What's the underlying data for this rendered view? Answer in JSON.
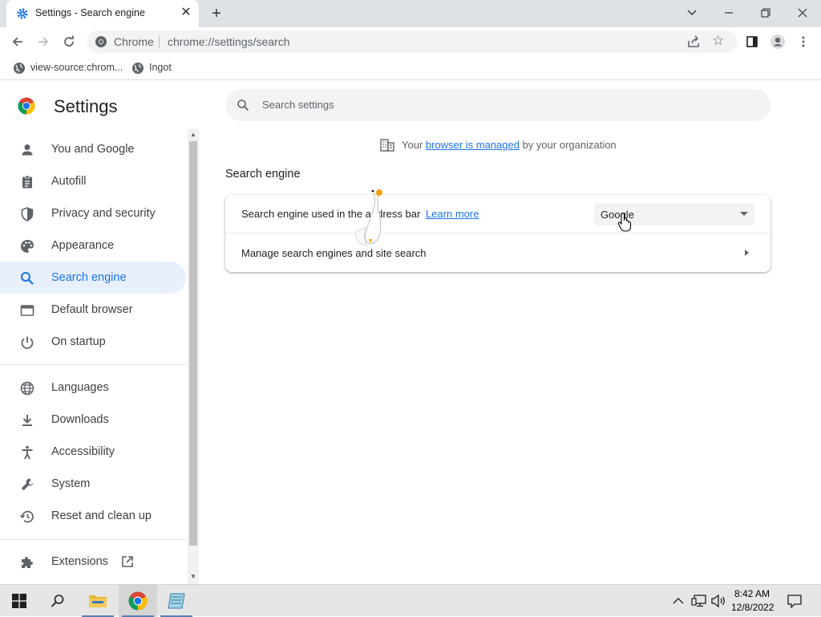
{
  "browser": {
    "tab_title": "Settings - Search engine",
    "omnibox_chip": "Chrome",
    "url": "chrome://settings/search"
  },
  "bookmarks": [
    {
      "label": "view-source:chrom..."
    },
    {
      "label": "Ingot"
    }
  ],
  "settings": {
    "title": "Settings",
    "search_placeholder": "Search settings"
  },
  "sidebar": {
    "items": [
      {
        "label": "You and Google",
        "icon": "person-icon"
      },
      {
        "label": "Autofill",
        "icon": "clipboard-icon"
      },
      {
        "label": "Privacy and security",
        "icon": "shield-icon"
      },
      {
        "label": "Appearance",
        "icon": "palette-icon"
      },
      {
        "label": "Search engine",
        "icon": "search-icon",
        "selected": true
      },
      {
        "label": "Default browser",
        "icon": "browser-window-icon"
      },
      {
        "label": "On startup",
        "icon": "power-icon"
      },
      {
        "label": "Languages",
        "icon": "globe-icon"
      },
      {
        "label": "Downloads",
        "icon": "download-icon"
      },
      {
        "label": "Accessibility",
        "icon": "accessibility-icon"
      },
      {
        "label": "System",
        "icon": "wrench-icon"
      },
      {
        "label": "Reset and clean up",
        "icon": "restore-icon"
      },
      {
        "label": "Extensions",
        "icon": "puzzle-icon"
      }
    ]
  },
  "managed_notice": {
    "prefix": "Your",
    "link": "browser is managed",
    "suffix": "by your organization"
  },
  "section": {
    "title": "Search engine",
    "row1_label": "Search engine used in the address bar",
    "row1_link": "Learn more",
    "selected_engine": "Google",
    "row2_label": "Manage search engines and site search"
  },
  "taskbar": {
    "time": "8:42 AM",
    "date": "12/8/2022"
  },
  "colors": {
    "accent": "#1a73e8",
    "selected_bg": "#e8f0fe",
    "tabstrip": "#dee1e6"
  }
}
